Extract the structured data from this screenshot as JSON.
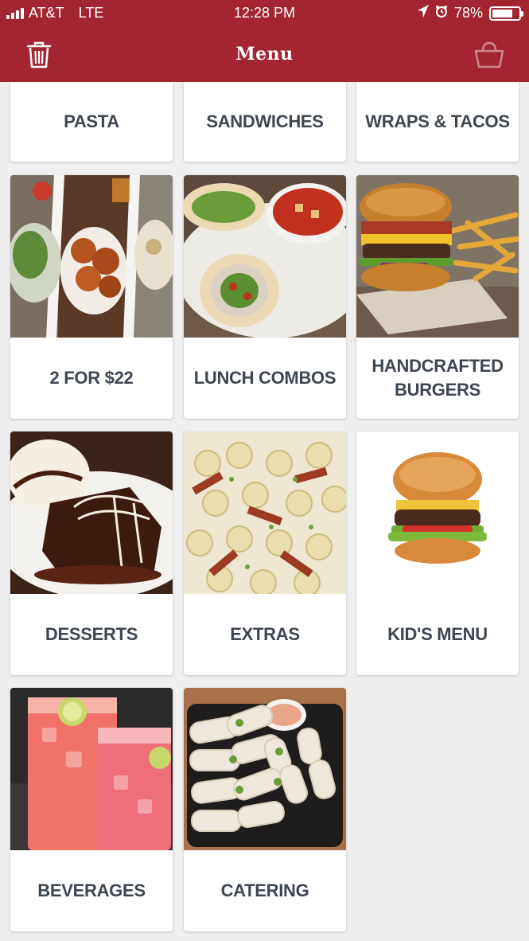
{
  "status_bar": {
    "carrier": "AT&T",
    "network": "LTE",
    "time": "12:28 PM",
    "battery": "78%",
    "battery_level": 0.78
  },
  "nav": {
    "title": "Menu",
    "left_icon": "trash-icon",
    "right_icon": "basket-icon"
  },
  "categories": [
    {
      "label": "PASTA"
    },
    {
      "label": "SANDWICHES"
    },
    {
      "label": "WRAPS & TACOS"
    },
    {
      "label": "2 FOR $22"
    },
    {
      "label": "LUNCH COMBOS"
    },
    {
      "label": "HANDCRAFTED BURGERS"
    },
    {
      "label": "DESSERTS"
    },
    {
      "label": "EXTRAS"
    },
    {
      "label": "KID'S MENU"
    },
    {
      "label": "BEVERAGES"
    },
    {
      "label": "CATERING"
    }
  ],
  "colors": {
    "brand_red": "#a2252f",
    "label_text": "#3e4652",
    "background": "#efefef"
  }
}
